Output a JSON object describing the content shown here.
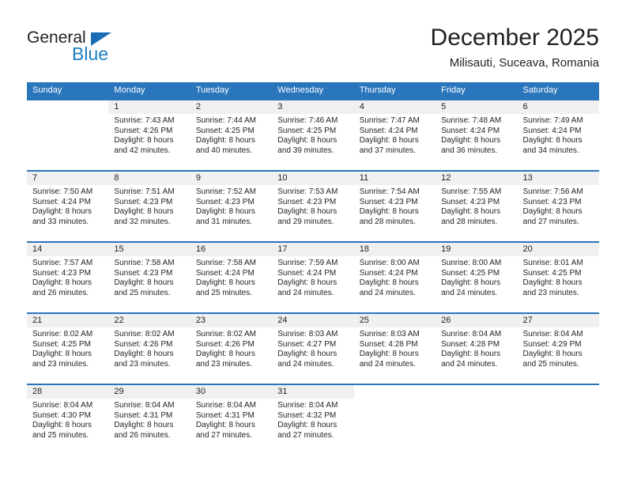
{
  "logo": {
    "word_one": "General",
    "word_two": "Blue",
    "triangle_icon": "triangle-icon",
    "accent_color": "#1f7fc4"
  },
  "header": {
    "title": "December 2025",
    "subtitle": "Milisauti, Suceava, Romania"
  },
  "colors": {
    "header_band": "#2a76bc",
    "daynum_band": "#f0f0f0",
    "text": "#231f20"
  },
  "calendar": {
    "weekday_headers": [
      "Sunday",
      "Monday",
      "Tuesday",
      "Wednesday",
      "Thursday",
      "Friday",
      "Saturday"
    ],
    "weeks": [
      [
        {
          "day": "",
          "sunrise": "",
          "sunset": "",
          "daylight_line1": "",
          "daylight_line2": ""
        },
        {
          "day": "1",
          "sunrise": "Sunrise: 7:43 AM",
          "sunset": "Sunset: 4:26 PM",
          "daylight_line1": "Daylight: 8 hours",
          "daylight_line2": "and 42 minutes."
        },
        {
          "day": "2",
          "sunrise": "Sunrise: 7:44 AM",
          "sunset": "Sunset: 4:25 PM",
          "daylight_line1": "Daylight: 8 hours",
          "daylight_line2": "and 40 minutes."
        },
        {
          "day": "3",
          "sunrise": "Sunrise: 7:46 AM",
          "sunset": "Sunset: 4:25 PM",
          "daylight_line1": "Daylight: 8 hours",
          "daylight_line2": "and 39 minutes."
        },
        {
          "day": "4",
          "sunrise": "Sunrise: 7:47 AM",
          "sunset": "Sunset: 4:24 PM",
          "daylight_line1": "Daylight: 8 hours",
          "daylight_line2": "and 37 minutes."
        },
        {
          "day": "5",
          "sunrise": "Sunrise: 7:48 AM",
          "sunset": "Sunset: 4:24 PM",
          "daylight_line1": "Daylight: 8 hours",
          "daylight_line2": "and 36 minutes."
        },
        {
          "day": "6",
          "sunrise": "Sunrise: 7:49 AM",
          "sunset": "Sunset: 4:24 PM",
          "daylight_line1": "Daylight: 8 hours",
          "daylight_line2": "and 34 minutes."
        }
      ],
      [
        {
          "day": "7",
          "sunrise": "Sunrise: 7:50 AM",
          "sunset": "Sunset: 4:24 PM",
          "daylight_line1": "Daylight: 8 hours",
          "daylight_line2": "and 33 minutes."
        },
        {
          "day": "8",
          "sunrise": "Sunrise: 7:51 AM",
          "sunset": "Sunset: 4:23 PM",
          "daylight_line1": "Daylight: 8 hours",
          "daylight_line2": "and 32 minutes."
        },
        {
          "day": "9",
          "sunrise": "Sunrise: 7:52 AM",
          "sunset": "Sunset: 4:23 PM",
          "daylight_line1": "Daylight: 8 hours",
          "daylight_line2": "and 31 minutes."
        },
        {
          "day": "10",
          "sunrise": "Sunrise: 7:53 AM",
          "sunset": "Sunset: 4:23 PM",
          "daylight_line1": "Daylight: 8 hours",
          "daylight_line2": "and 29 minutes."
        },
        {
          "day": "11",
          "sunrise": "Sunrise: 7:54 AM",
          "sunset": "Sunset: 4:23 PM",
          "daylight_line1": "Daylight: 8 hours",
          "daylight_line2": "and 28 minutes."
        },
        {
          "day": "12",
          "sunrise": "Sunrise: 7:55 AM",
          "sunset": "Sunset: 4:23 PM",
          "daylight_line1": "Daylight: 8 hours",
          "daylight_line2": "and 28 minutes."
        },
        {
          "day": "13",
          "sunrise": "Sunrise: 7:56 AM",
          "sunset": "Sunset: 4:23 PM",
          "daylight_line1": "Daylight: 8 hours",
          "daylight_line2": "and 27 minutes."
        }
      ],
      [
        {
          "day": "14",
          "sunrise": "Sunrise: 7:57 AM",
          "sunset": "Sunset: 4:23 PM",
          "daylight_line1": "Daylight: 8 hours",
          "daylight_line2": "and 26 minutes."
        },
        {
          "day": "15",
          "sunrise": "Sunrise: 7:58 AM",
          "sunset": "Sunset: 4:23 PM",
          "daylight_line1": "Daylight: 8 hours",
          "daylight_line2": "and 25 minutes."
        },
        {
          "day": "16",
          "sunrise": "Sunrise: 7:58 AM",
          "sunset": "Sunset: 4:24 PM",
          "daylight_line1": "Daylight: 8 hours",
          "daylight_line2": "and 25 minutes."
        },
        {
          "day": "17",
          "sunrise": "Sunrise: 7:59 AM",
          "sunset": "Sunset: 4:24 PM",
          "daylight_line1": "Daylight: 8 hours",
          "daylight_line2": "and 24 minutes."
        },
        {
          "day": "18",
          "sunrise": "Sunrise: 8:00 AM",
          "sunset": "Sunset: 4:24 PM",
          "daylight_line1": "Daylight: 8 hours",
          "daylight_line2": "and 24 minutes."
        },
        {
          "day": "19",
          "sunrise": "Sunrise: 8:00 AM",
          "sunset": "Sunset: 4:25 PM",
          "daylight_line1": "Daylight: 8 hours",
          "daylight_line2": "and 24 minutes."
        },
        {
          "day": "20",
          "sunrise": "Sunrise: 8:01 AM",
          "sunset": "Sunset: 4:25 PM",
          "daylight_line1": "Daylight: 8 hours",
          "daylight_line2": "and 23 minutes."
        }
      ],
      [
        {
          "day": "21",
          "sunrise": "Sunrise: 8:02 AM",
          "sunset": "Sunset: 4:25 PM",
          "daylight_line1": "Daylight: 8 hours",
          "daylight_line2": "and 23 minutes."
        },
        {
          "day": "22",
          "sunrise": "Sunrise: 8:02 AM",
          "sunset": "Sunset: 4:26 PM",
          "daylight_line1": "Daylight: 8 hours",
          "daylight_line2": "and 23 minutes."
        },
        {
          "day": "23",
          "sunrise": "Sunrise: 8:02 AM",
          "sunset": "Sunset: 4:26 PM",
          "daylight_line1": "Daylight: 8 hours",
          "daylight_line2": "and 23 minutes."
        },
        {
          "day": "24",
          "sunrise": "Sunrise: 8:03 AM",
          "sunset": "Sunset: 4:27 PM",
          "daylight_line1": "Daylight: 8 hours",
          "daylight_line2": "and 24 minutes."
        },
        {
          "day": "25",
          "sunrise": "Sunrise: 8:03 AM",
          "sunset": "Sunset: 4:28 PM",
          "daylight_line1": "Daylight: 8 hours",
          "daylight_line2": "and 24 minutes."
        },
        {
          "day": "26",
          "sunrise": "Sunrise: 8:04 AM",
          "sunset": "Sunset: 4:28 PM",
          "daylight_line1": "Daylight: 8 hours",
          "daylight_line2": "and 24 minutes."
        },
        {
          "day": "27",
          "sunrise": "Sunrise: 8:04 AM",
          "sunset": "Sunset: 4:29 PM",
          "daylight_line1": "Daylight: 8 hours",
          "daylight_line2": "and 25 minutes."
        }
      ],
      [
        {
          "day": "28",
          "sunrise": "Sunrise: 8:04 AM",
          "sunset": "Sunset: 4:30 PM",
          "daylight_line1": "Daylight: 8 hours",
          "daylight_line2": "and 25 minutes."
        },
        {
          "day": "29",
          "sunrise": "Sunrise: 8:04 AM",
          "sunset": "Sunset: 4:31 PM",
          "daylight_line1": "Daylight: 8 hours",
          "daylight_line2": "and 26 minutes."
        },
        {
          "day": "30",
          "sunrise": "Sunrise: 8:04 AM",
          "sunset": "Sunset: 4:31 PM",
          "daylight_line1": "Daylight: 8 hours",
          "daylight_line2": "and 27 minutes."
        },
        {
          "day": "31",
          "sunrise": "Sunrise: 8:04 AM",
          "sunset": "Sunset: 4:32 PM",
          "daylight_line1": "Daylight: 8 hours",
          "daylight_line2": "and 27 minutes."
        },
        {
          "day": "",
          "sunrise": "",
          "sunset": "",
          "daylight_line1": "",
          "daylight_line2": ""
        },
        {
          "day": "",
          "sunrise": "",
          "sunset": "",
          "daylight_line1": "",
          "daylight_line2": ""
        },
        {
          "day": "",
          "sunrise": "",
          "sunset": "",
          "daylight_line1": "",
          "daylight_line2": ""
        }
      ]
    ]
  }
}
